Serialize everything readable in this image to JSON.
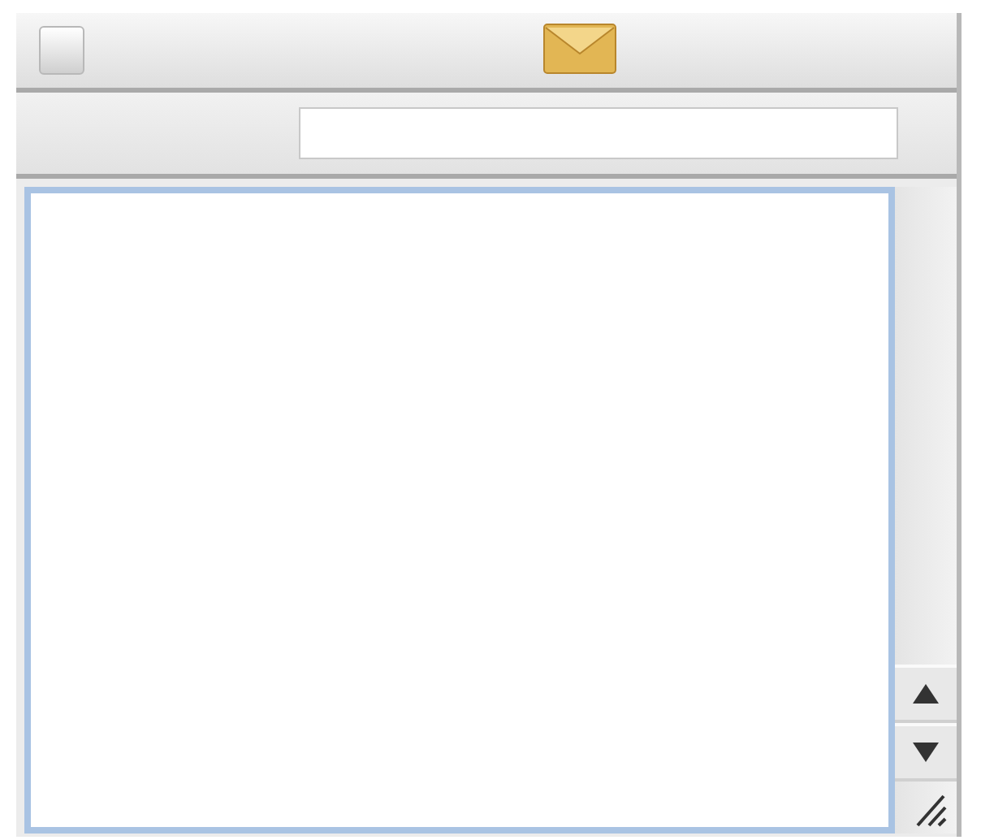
{
  "address_field": {
    "focused": false
  },
  "message_area": {
    "focused": true
  }
}
